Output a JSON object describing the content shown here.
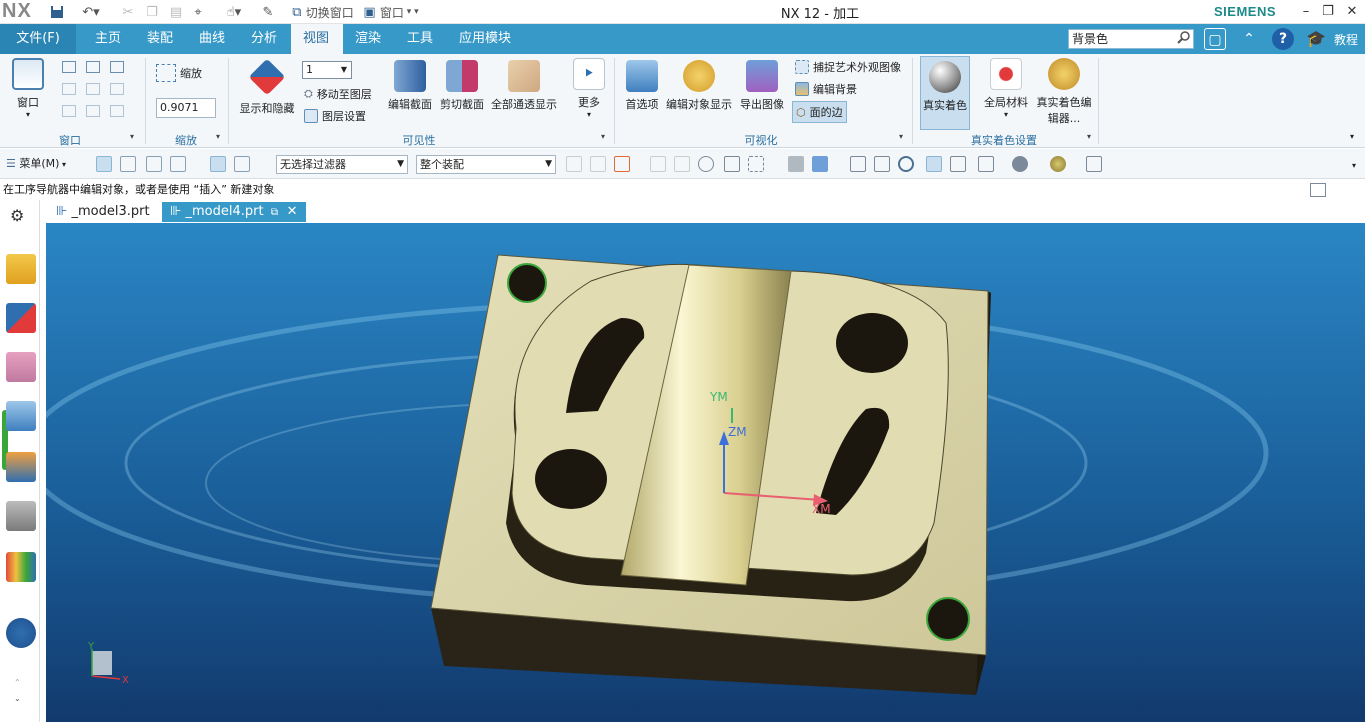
{
  "window": {
    "logo": "NX",
    "title": "NX 12 - 加工",
    "brand": "SIEMENS",
    "switch_window": "切换窗口",
    "window_menu": "窗口"
  },
  "ribbon_tabs": [
    {
      "label": "文件(F)"
    },
    {
      "label": "主页"
    },
    {
      "label": "装配"
    },
    {
      "label": "曲线"
    },
    {
      "label": "分析"
    },
    {
      "label": "视图",
      "active": true
    },
    {
      "label": "渲染"
    },
    {
      "label": "工具"
    },
    {
      "label": "应用模块"
    }
  ],
  "search": {
    "value": "背景色"
  },
  "help": {
    "tutorial": "教程"
  },
  "ribbon": {
    "window_group": {
      "button": "窗口",
      "label": "窗口"
    },
    "zoom_group": {
      "button": "缩放",
      "value": "0.9071",
      "label": "缩放"
    },
    "visibility_group": {
      "show_hide": "显示和隐藏",
      "layer_value": "1",
      "move_to_layer": "移动至图层",
      "layer_settings": "图层设置",
      "edit_section": "编辑截面",
      "clip_section": "剪切截面",
      "all_pass": "全部通透显示",
      "more": "更多",
      "label": "可见性"
    },
    "visualization_group": {
      "preferences": "首选项",
      "edit_object_display": "编辑对象显示",
      "export_image": "导出图像",
      "capture_art": "捕捉艺术外观图像",
      "edit_background": "编辑背景",
      "face_edges": "面的边",
      "label": "可视化"
    },
    "true_shading_group": {
      "true_shading": "真实着色",
      "global_material": "全局材料",
      "true_shading_editor": "真实着色编辑器...",
      "label": "真实着色设置"
    }
  },
  "toolbar2": {
    "menu": "菜单(M)",
    "filter": "无选择过滤器",
    "scope": "整个装配"
  },
  "status": {
    "message": "在工序导航器中编辑对象，或者是使用 “插入” 新建对象"
  },
  "doc_tabs": [
    {
      "label": "_model3.prt"
    },
    {
      "label": "_model4.prt",
      "active": true
    }
  ],
  "viewport": {
    "axes": {
      "ym": "YM",
      "zm": "ZM",
      "xm": "XM"
    },
    "triad": {
      "y": "Y",
      "x": "X"
    }
  },
  "colors": {
    "accent": "#3799c8",
    "file_tab": "#2a85b5",
    "part_face": "#d9d3a4",
    "part_side": "#2a2418",
    "background_top": "#1e6ea8",
    "background_bottom": "#123a6e"
  }
}
